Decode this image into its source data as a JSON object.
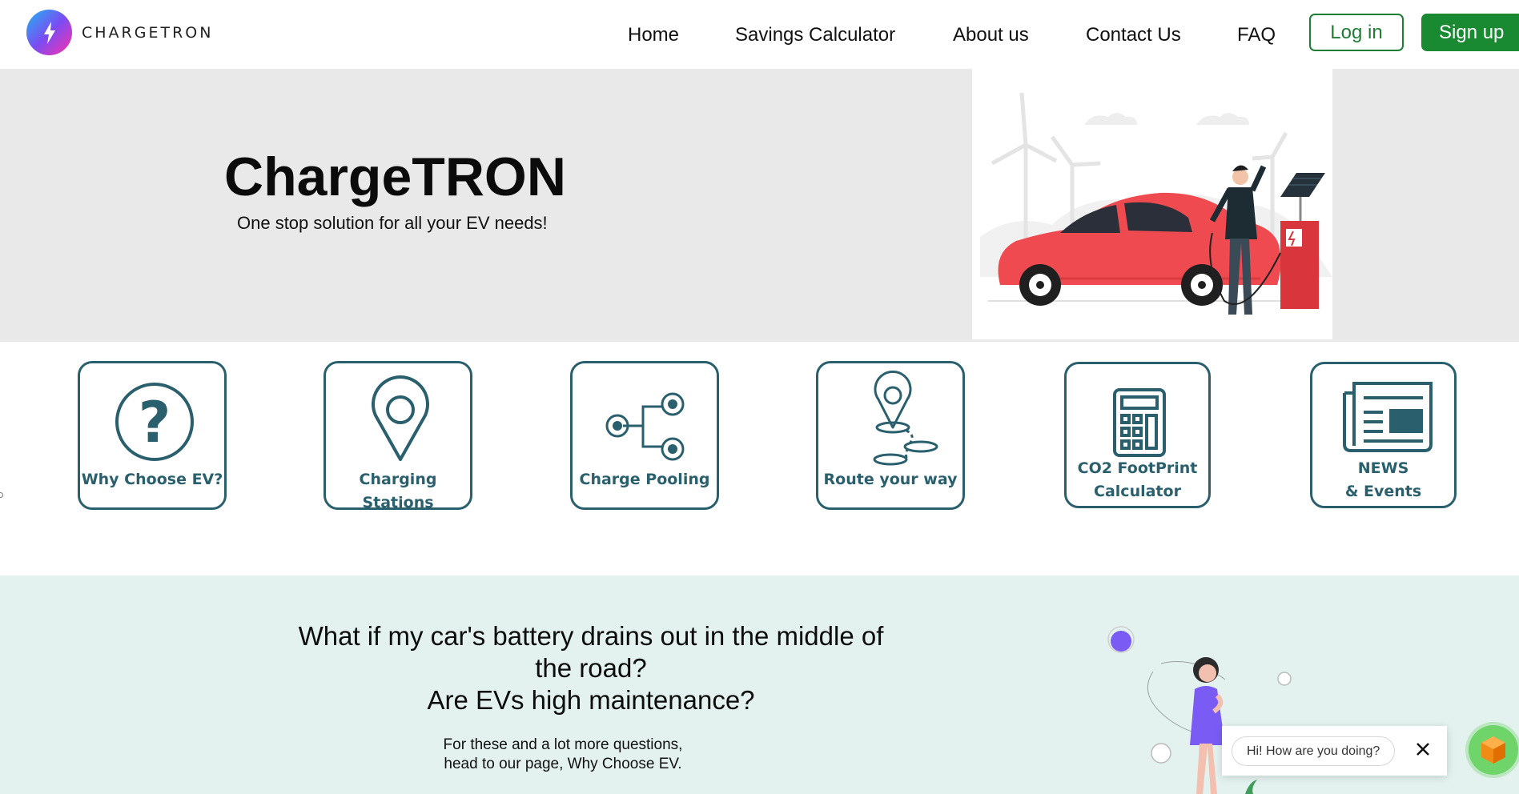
{
  "brand": {
    "name": "CHARGETRON",
    "logo_icon": "lightning-icon",
    "logo_gradient": [
      "#1fb6f2",
      "#7a4df3",
      "#ff2fa8"
    ]
  },
  "nav": {
    "links": [
      "Home",
      "Savings Calculator",
      "About us",
      "Contact Us",
      "FAQ"
    ],
    "login_label": "Log in",
    "signup_label": "Sign up"
  },
  "hero": {
    "title": "ChargeTRON",
    "subtitle": "One stop solution for all your EV needs!",
    "illustration": "person-charging-red-car-illustration"
  },
  "features": [
    {
      "label": "Why Choose EV?",
      "icon": "question-circle-icon"
    },
    {
      "label": "Charging Stations",
      "icon": "map-pin-icon"
    },
    {
      "label": "Charge Pooling",
      "icon": "share-nodes-icon"
    },
    {
      "label": "Route your way",
      "icon": "route-icon"
    },
    {
      "label_line1": "CO2 FootPrint",
      "label_line2": "Calculator",
      "icon": "calculator-icon"
    },
    {
      "label_line1": "NEWS",
      "label_line2": "& Events",
      "icon": "newspaper-icon"
    }
  ],
  "promo": {
    "question_line1": "What if my car's battery drains out in the middle of",
    "question_line2": "the road?",
    "question_line3": "Are EVs high maintenance?",
    "text_line1": "For these and a lot more questions,",
    "text_line2": "head to our page, Why Choose EV.",
    "illustration": "woman-thinking-illustration"
  },
  "chat": {
    "greeting": "Hi! How are you doing?",
    "close_icon": "close-icon",
    "launcher_icon": "cube-icon"
  },
  "colors": {
    "accent_teal": "#2a5f6d",
    "login_green": "#1e7e34",
    "signup_green": "#198a32",
    "hero_bg": "#e9e9e9",
    "promo_bg": "#e3f1ef"
  }
}
